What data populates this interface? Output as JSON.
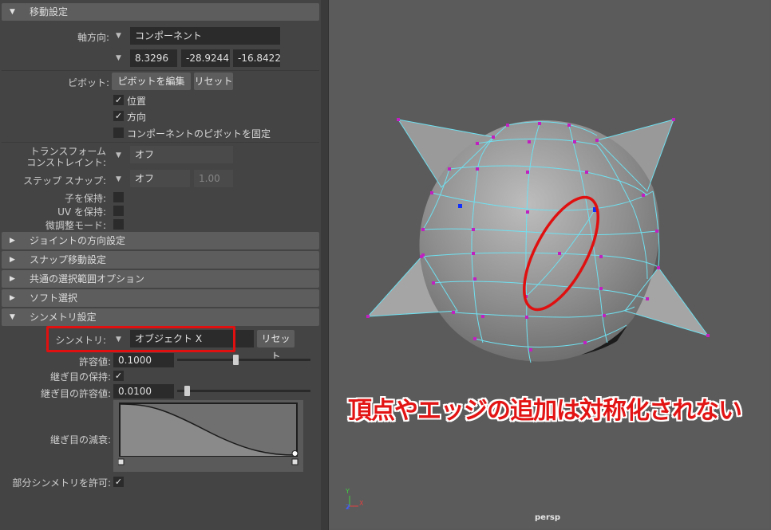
{
  "sections": {
    "move_settings": "移動設定",
    "joint_orient": "ジョイントの方向設定",
    "snap_move": "スナップ移動設定",
    "common_selection": "共通の選択範囲オプション",
    "soft_select": "ソフト選択",
    "symmetry_settings": "シンメトリ設定"
  },
  "axis": {
    "label": "軸方向:",
    "value": "コンポーネント",
    "x": "8.3296",
    "y": "-28.9244",
    "z": "-16.8422"
  },
  "pivot": {
    "label": "ピボット:",
    "edit_button": "ピボットを編集",
    "reset_button": "リセット",
    "position_label": "位置",
    "position_checked": "✓",
    "orientation_label": "方向",
    "orientation_checked": "✓",
    "fix_component_label": "コンポーネントのピボットを固定"
  },
  "transform": {
    "constraint_label_1": "トランスフォーム",
    "constraint_label_2": "コンストレイント:",
    "constraint_value": "オフ",
    "step_snap_label": "ステップ スナップ:",
    "step_snap_value": "オフ",
    "step_snap_amount": "1.00",
    "preserve_children_label": "子を保持:",
    "preserve_uv_label": "UV を保持:",
    "tweak_mode_label": "微調整モード:"
  },
  "symmetry": {
    "label": "シンメトリ:",
    "value": "オブジェクト X",
    "reset_button": "リセット",
    "tolerance_label": "許容値:",
    "tolerance_value": "0.1000",
    "tolerance_fraction": 0.44,
    "preserve_seam_label": "継ぎ目の保持:",
    "preserve_seam_checked": "✓",
    "seam_tolerance_label": "継ぎ目の許容値:",
    "seam_tolerance_value": "0.0100",
    "seam_tolerance_fraction": 0.07,
    "seam_falloff_label": "継ぎ目の減衰:",
    "partial_symmetry_label": "部分シンメトリを許可:",
    "partial_symmetry_checked": "✓"
  },
  "viewport": {
    "overlay_text": "頂点やエッジの追加は対称化されない",
    "camera_label": "persp",
    "axis_y": "Y",
    "axis_x": "X",
    "axis_z": "Z"
  },
  "colors": {
    "highlight_red": "#e01010",
    "wire_cyan": "#6fe0f0",
    "vertex_magenta": "#c020c0",
    "selected_vertex_blue": "#1030ff"
  }
}
